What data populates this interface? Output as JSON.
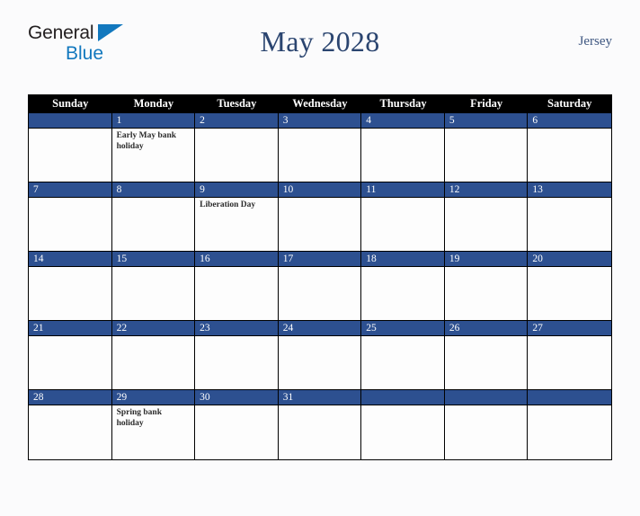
{
  "brand": {
    "line1": "General",
    "line2": "Blue",
    "triangle_color": "#1278be"
  },
  "header": {
    "title": "May 2028",
    "region": "Jersey",
    "title_color": "#2b4570"
  },
  "calendar": {
    "weekdays": [
      "Sunday",
      "Monday",
      "Tuesday",
      "Wednesday",
      "Thursday",
      "Friday",
      "Saturday"
    ],
    "header_bg": "#000000",
    "daynum_bg": "#2d5090",
    "weeks": [
      [
        {
          "day": "",
          "events": []
        },
        {
          "day": "1",
          "events": [
            "Early May bank holiday"
          ]
        },
        {
          "day": "2",
          "events": []
        },
        {
          "day": "3",
          "events": []
        },
        {
          "day": "4",
          "events": []
        },
        {
          "day": "5",
          "events": []
        },
        {
          "day": "6",
          "events": []
        }
      ],
      [
        {
          "day": "7",
          "events": []
        },
        {
          "day": "8",
          "events": []
        },
        {
          "day": "9",
          "events": [
            "Liberation Day"
          ]
        },
        {
          "day": "10",
          "events": []
        },
        {
          "day": "11",
          "events": []
        },
        {
          "day": "12",
          "events": []
        },
        {
          "day": "13",
          "events": []
        }
      ],
      [
        {
          "day": "14",
          "events": []
        },
        {
          "day": "15",
          "events": []
        },
        {
          "day": "16",
          "events": []
        },
        {
          "day": "17",
          "events": []
        },
        {
          "day": "18",
          "events": []
        },
        {
          "day": "19",
          "events": []
        },
        {
          "day": "20",
          "events": []
        }
      ],
      [
        {
          "day": "21",
          "events": []
        },
        {
          "day": "22",
          "events": []
        },
        {
          "day": "23",
          "events": []
        },
        {
          "day": "24",
          "events": []
        },
        {
          "day": "25",
          "events": []
        },
        {
          "day": "26",
          "events": []
        },
        {
          "day": "27",
          "events": []
        }
      ],
      [
        {
          "day": "28",
          "events": []
        },
        {
          "day": "29",
          "events": [
            "Spring bank holiday"
          ]
        },
        {
          "day": "30",
          "events": []
        },
        {
          "day": "31",
          "events": []
        },
        {
          "day": "",
          "events": []
        },
        {
          "day": "",
          "events": []
        },
        {
          "day": "",
          "events": []
        }
      ]
    ]
  }
}
